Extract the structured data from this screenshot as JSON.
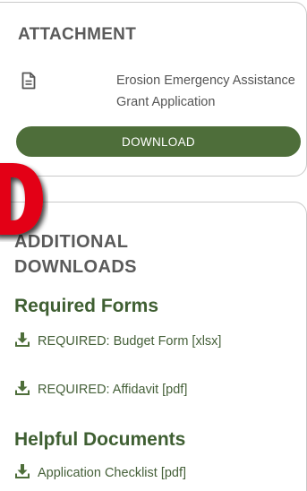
{
  "attachment": {
    "title": "ATTACHMENT",
    "file_icon": "document-icon",
    "file_name": "Erosion Emergency Assistance Grant Application",
    "download_label": "DOWNLOAD"
  },
  "downloads": {
    "title_line1": "ADDITIONAL",
    "title_line2": "DOWNLOADS",
    "overlay_letter": "D",
    "overlay_color": "#e30613",
    "sections": [
      {
        "heading": "Required Forms",
        "links": [
          {
            "icon": "download-icon",
            "label": "REQUIRED: Budget Form [xlsx]"
          },
          {
            "icon": "download-icon",
            "label": "REQUIRED: Affidavit [pdf]"
          }
        ]
      },
      {
        "heading": "Helpful Documents",
        "links": [
          {
            "icon": "download-icon",
            "label": "Application Checklist [pdf]"
          }
        ]
      }
    ]
  },
  "colors": {
    "accent_green": "#4e6e3a",
    "heading_green": "#3f5f32",
    "link_green": "#46613a",
    "text_gray": "#555555",
    "border_gray": "#c9c9c9"
  }
}
